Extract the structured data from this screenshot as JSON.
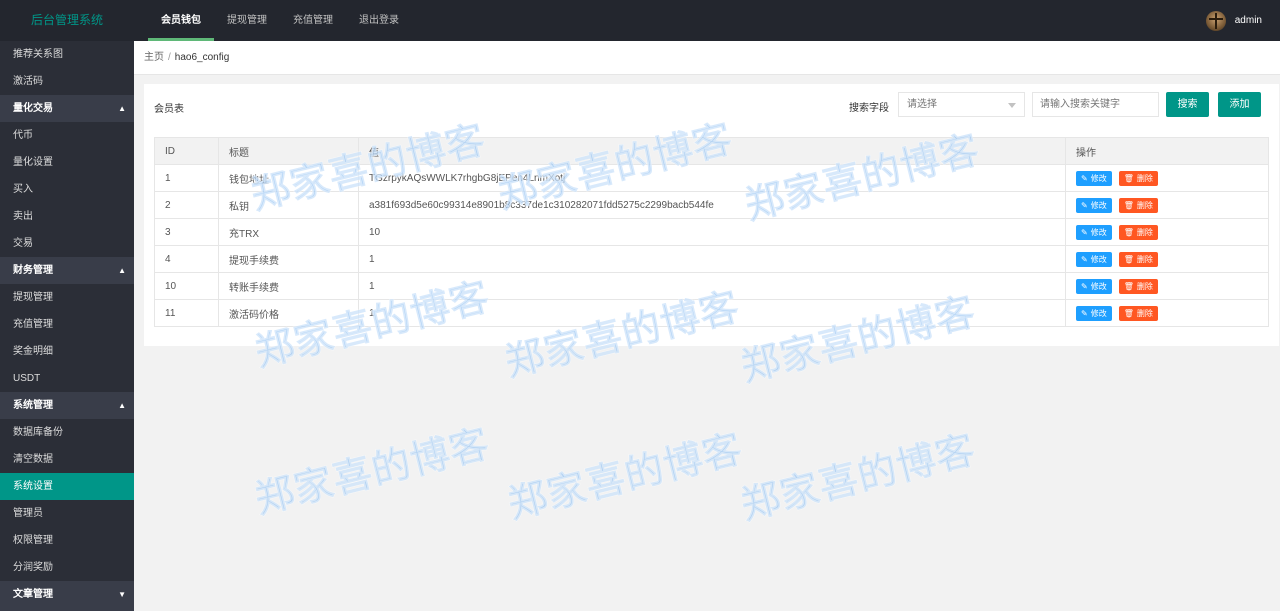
{
  "app": {
    "title": "后台管理系统"
  },
  "topnav": [
    {
      "label": "会员钱包",
      "active": true
    },
    {
      "label": "提现管理",
      "active": false
    },
    {
      "label": "充值管理",
      "active": false
    },
    {
      "label": "退出登录",
      "active": false
    }
  ],
  "user": {
    "name": "admin",
    "avatar_icon": "avatar-icon"
  },
  "sidebar": [
    {
      "label": "推荐关系图",
      "kind": "sub"
    },
    {
      "label": "激活码",
      "kind": "sub"
    },
    {
      "label": "量化交易",
      "kind": "group",
      "caret": "▲"
    },
    {
      "label": "代币",
      "kind": "sub"
    },
    {
      "label": "量化设置",
      "kind": "sub"
    },
    {
      "label": "买入",
      "kind": "sub"
    },
    {
      "label": "卖出",
      "kind": "sub"
    },
    {
      "label": "交易",
      "kind": "sub"
    },
    {
      "label": "财务管理",
      "kind": "group",
      "caret": "▲"
    },
    {
      "label": "提现管理",
      "kind": "sub"
    },
    {
      "label": "充值管理",
      "kind": "sub"
    },
    {
      "label": "奖金明细",
      "kind": "sub"
    },
    {
      "label": "USDT",
      "kind": "sub"
    },
    {
      "label": "系统管理",
      "kind": "group",
      "caret": "▲"
    },
    {
      "label": "数据库备份",
      "kind": "sub"
    },
    {
      "label": "清空数据",
      "kind": "sub"
    },
    {
      "label": "系统设置",
      "kind": "selected"
    },
    {
      "label": "管理员",
      "kind": "sub"
    },
    {
      "label": "权限管理",
      "kind": "sub"
    },
    {
      "label": "分润奖励",
      "kind": "sub"
    },
    {
      "label": "文章管理",
      "kind": "group",
      "caret": "▼"
    }
  ],
  "breadcrumb": {
    "home": "主页",
    "separator": "/",
    "current": "hao6_config"
  },
  "card": {
    "title": "会员表",
    "search_label": "搜索字段",
    "select_placeholder": "请选择",
    "keyword_placeholder": "请输入搜索关键字",
    "search_button": "搜索",
    "add_button": "添加"
  },
  "table": {
    "headers": [
      "ID",
      "标题",
      "值",
      "操作"
    ],
    "rows": [
      {
        "id": "1",
        "title": "钱包地址",
        "value": "TGzrpykAQsWWLK7rhgbG8jEPen4LnmXotj"
      },
      {
        "id": "2",
        "title": "私钥",
        "value": "a381f693d5e60c99314e8901b8c337de1c310282071fdd5275c2299bacb544fe"
      },
      {
        "id": "3",
        "title": "充TRX",
        "value": "10"
      },
      {
        "id": "4",
        "title": "提现手续费",
        "value": "1"
      },
      {
        "id": "10",
        "title": "转账手续费",
        "value": "1"
      },
      {
        "id": "11",
        "title": "激活码价格",
        "value": "1"
      }
    ],
    "edit_label": "修改",
    "delete_label": "删除",
    "edit_icon": "pencil-icon",
    "delete_icon": "trash-icon"
  },
  "watermark": {
    "text": "郑家喜的博客"
  },
  "colors": {
    "topbar": "#23262e",
    "sidebar": "#393d49",
    "accent": "#009688",
    "edit": "#1e9fff",
    "delete": "#ff5722"
  }
}
